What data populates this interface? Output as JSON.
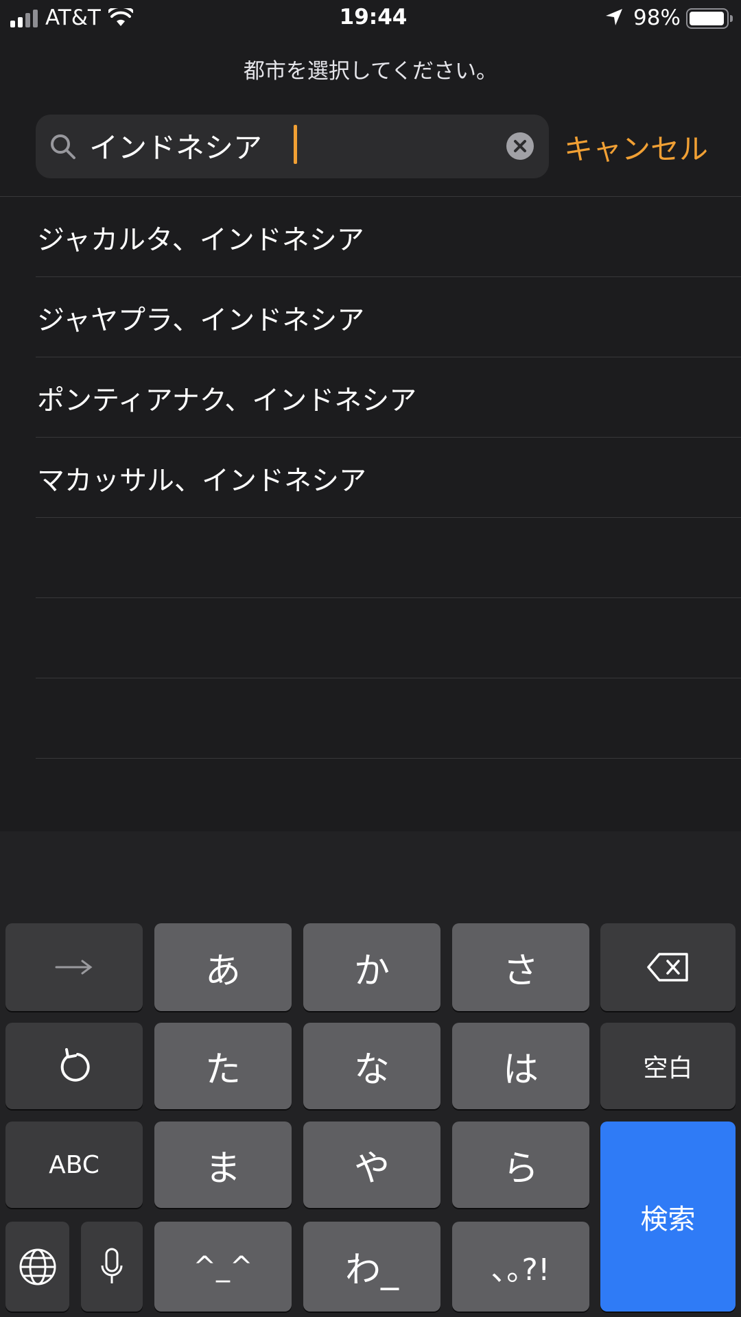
{
  "status": {
    "carrier": "AT&T",
    "time": "19:44",
    "battery": "98%"
  },
  "prompt": "都市を選択してください。",
  "search": {
    "value": "インドネシア",
    "cancel": "キャンセル"
  },
  "results": [
    "ジャカルタ、インドネシア",
    "ジャヤプラ、インドネシア",
    "ポンティアナク、インドネシア",
    "マカッサル、インドネシア"
  ],
  "keyboard": {
    "row1": [
      "あ",
      "か",
      "さ"
    ],
    "row2": [
      "た",
      "な",
      "は"
    ],
    "space": "空白",
    "abc": "ABC",
    "row3": [
      "ま",
      "や",
      "ら"
    ],
    "row4": [
      "^_^",
      "わ_",
      "､｡?!"
    ],
    "search": "検索"
  },
  "colors": {
    "accent": "#f1a034",
    "keyboard_action": "#2f7bf6"
  }
}
